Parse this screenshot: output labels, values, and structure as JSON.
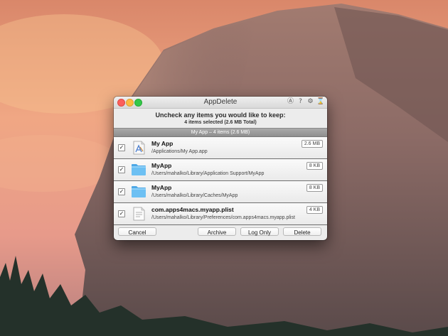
{
  "window": {
    "title": "AppDelete",
    "toolbar_icons": [
      "app-store-icon",
      "help-icon",
      "settings-icon",
      "hourglass-icon"
    ]
  },
  "header": {
    "heading": "Uncheck any items you would like to keep:",
    "subheading": "4 items selected (2.6 MB Total)"
  },
  "group": {
    "label": "My App – 4 items (2.6 MB)"
  },
  "items": [
    {
      "checked": true,
      "icon": "app-icon",
      "name": "My App",
      "path": "/Applications/My App.app",
      "size": "2.6 MB"
    },
    {
      "checked": true,
      "icon": "folder-icon",
      "name": "MyApp",
      "path": "/Users/mahalko/Library/Application Support/MyApp",
      "size": "8 KB"
    },
    {
      "checked": true,
      "icon": "folder-icon",
      "name": "MyApp",
      "path": "/Users/mahalko/Library/Caches/MyApp",
      "size": "8 KB"
    },
    {
      "checked": true,
      "icon": "plist-icon",
      "name": "com.apps4macs.myapp.plist",
      "path": "/Users/mahalko/Library/Preferences/com.apps4macs.myapp.plist",
      "size": "4 KB"
    }
  ],
  "buttons": {
    "cancel": "Cancel",
    "archive": "Archive",
    "log_only": "Log Only",
    "delete": "Delete"
  },
  "colors": {
    "folder": "#5fb6ef",
    "close": "#fc605c",
    "minimize": "#fdbc40",
    "zoom": "#34c84a"
  }
}
